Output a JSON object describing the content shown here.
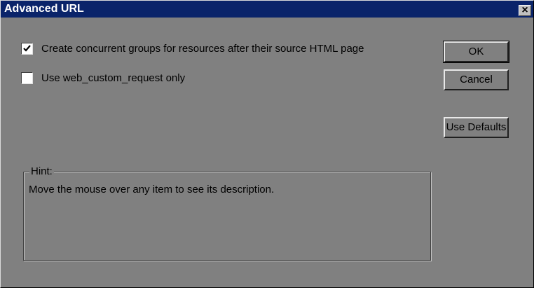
{
  "dialog": {
    "title": "Advanced URL",
    "close_label": "×"
  },
  "options": [
    {
      "label": "Create concurrent groups for resources after their source HTML page",
      "checked": true
    },
    {
      "label": "Use web_custom_request only",
      "checked": false
    }
  ],
  "buttons": {
    "ok": "OK",
    "cancel": "Cancel",
    "use_defaults": "Use Defaults"
  },
  "hint": {
    "legend": "Hint:",
    "text": "Move the mouse over any item to see its description."
  }
}
